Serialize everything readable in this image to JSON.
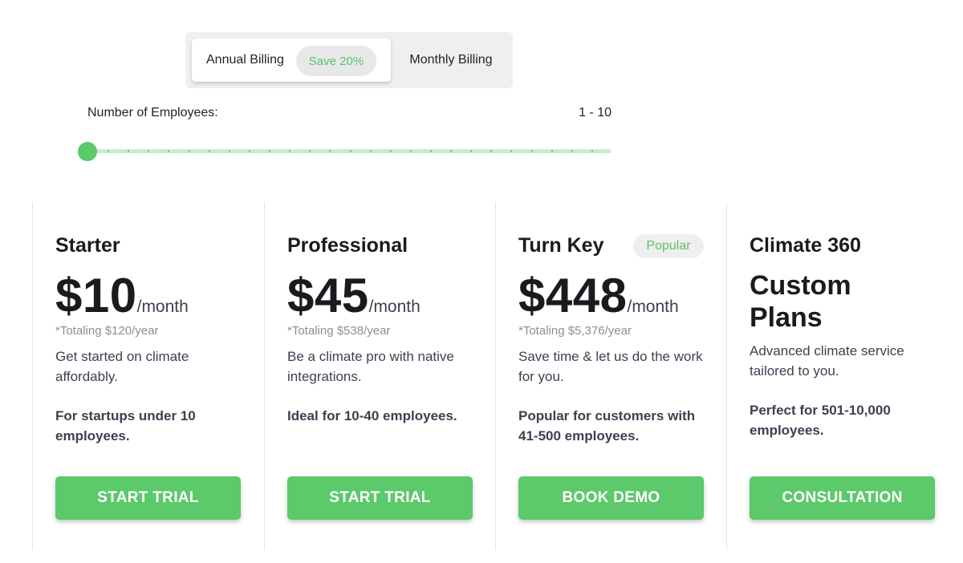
{
  "billing": {
    "annual_label": "Annual Billing",
    "save_badge": "Save 20%",
    "monthly_label": "Monthly Billing",
    "selected": "annual"
  },
  "employees": {
    "label": "Number of Employees:",
    "value": "1 - 10",
    "slider_position": 0,
    "tick_count": 26
  },
  "colors": {
    "accent": "#5cc96b",
    "accent_text": "#5cc26a",
    "track": "#c8eccd"
  },
  "plans": [
    {
      "name": "Starter",
      "price": "$10",
      "period": "/month",
      "total": "*Totaling $120/year",
      "description": "Get started on climate affordably.",
      "audience": "For startups under 10 employees.",
      "cta": "START TRIAL"
    },
    {
      "name": "Professional",
      "price": "$45",
      "period": "/month",
      "total": "*Totaling $538/year",
      "description": "Be a climate pro with native integrations.",
      "audience": "Ideal for 10-40 employees.",
      "cta": "START TRIAL"
    },
    {
      "name": "Turn Key",
      "badge": "Popular",
      "price": "$448",
      "period": "/month",
      "total": "*Totaling $5,376/year",
      "description": "Save time & let us do the work for you.",
      "audience": "Popular for customers with 41-500 employees.",
      "cta": "BOOK DEMO"
    },
    {
      "name": "Climate 360",
      "custom_title": "Custom Plans",
      "description": "Advanced climate service tailored to you.",
      "audience": "Perfect for 501-10,000 employees.",
      "cta": "CONSULTATION"
    }
  ]
}
